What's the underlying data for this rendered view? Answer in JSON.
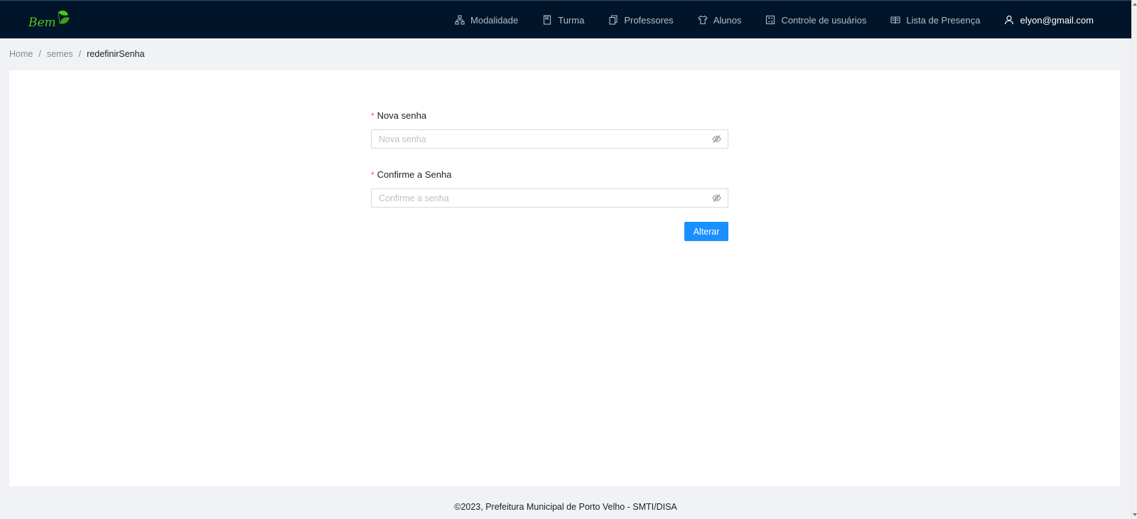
{
  "header": {
    "logo_text": "Bem",
    "nav": [
      {
        "label": "Modalidade",
        "icon": "sitemap-icon"
      },
      {
        "label": "Turma",
        "icon": "book-icon"
      },
      {
        "label": "Professores",
        "icon": "copy-icon"
      },
      {
        "label": "Alunos",
        "icon": "shirt-icon"
      },
      {
        "label": "Controle de usuários",
        "icon": "calculator-icon"
      },
      {
        "label": "Lista de Presença",
        "icon": "read-icon"
      }
    ],
    "user_email": "elyon@gmail.com",
    "user_icon": "user-icon"
  },
  "breadcrumb": {
    "items": [
      "Home",
      "semes"
    ],
    "current": "redefinirSenha",
    "separator": "/"
  },
  "form": {
    "required_mark": "*",
    "new_password": {
      "label": "Nova senha",
      "placeholder": "Nova senha",
      "value": ""
    },
    "confirm_password": {
      "label": "Confirme a Senha",
      "placeholder": "Confirme a senha",
      "value": ""
    },
    "submit_label": "Alterar"
  },
  "footer": {
    "text": "©2023, Prefeitura Municipal de Porto Velho - SMTI/DISA"
  },
  "colors": {
    "header_bg": "#001529",
    "primary": "#1890ff",
    "page_bg": "#f0f2f5",
    "logo_green": "#52c41a"
  }
}
